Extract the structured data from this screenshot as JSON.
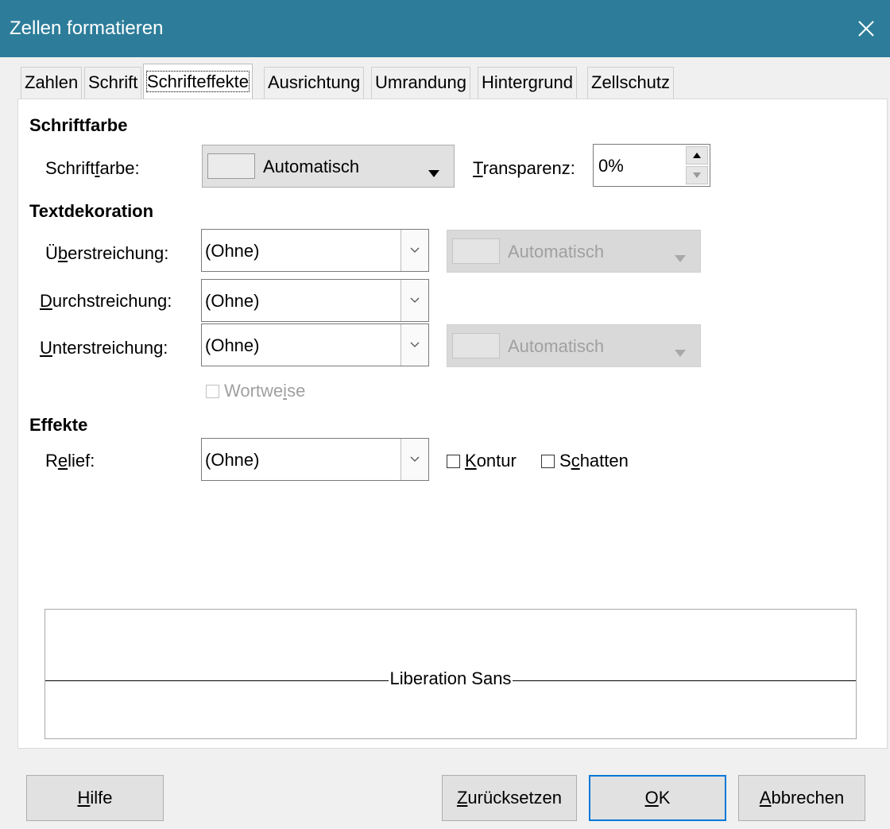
{
  "window": {
    "title": "Zellen formatieren"
  },
  "tabs": [
    "Zahlen",
    "Schrift",
    "Schrifteffekte",
    "Ausrichtung",
    "Umrandung",
    "Hintergrund",
    "Zellschutz"
  ],
  "active_tab": "Schrifteffekte",
  "font_color": {
    "heading": "Schriftfarbe",
    "label_pre": "Schrift",
    "label_acc": "f",
    "label_post": "arbe:",
    "value": "Automatisch",
    "transparency_label_acc": "T",
    "transparency_label_post": "ransparenz:",
    "transparency_value": "0%"
  },
  "decoration": {
    "heading": "Textdekoration",
    "overline": {
      "label_pre": "Ü",
      "label_acc": "b",
      "label_post": "erstreichung:",
      "value": "(Ohne)",
      "color": "Automatisch"
    },
    "strikethrough": {
      "label_acc": "D",
      "label_post": "urchstreichung:",
      "value": "(Ohne)"
    },
    "underline": {
      "label_acc": "U",
      "label_post": "nterstreichung:",
      "value": "(Ohne)",
      "color": "Automatisch"
    },
    "word_by_word": {
      "label_pre": "Wortwe",
      "label_acc": "i",
      "label_post": "se"
    }
  },
  "effects": {
    "heading": "Effekte",
    "relief": {
      "label_pre": "R",
      "label_acc": "e",
      "label_post": "lief:",
      "value": "(Ohne)"
    },
    "outline": {
      "label_acc": "K",
      "label_post": "ontur"
    },
    "shadow": {
      "label_pre": "S",
      "label_acc": "c",
      "label_post": "hatten"
    }
  },
  "preview": {
    "text": "Liberation Sans"
  },
  "buttons": {
    "help": {
      "acc": "H",
      "post": "ilfe"
    },
    "reset": {
      "acc": "Z",
      "post": "urücksetzen"
    },
    "ok": {
      "acc": "O",
      "post": "K"
    },
    "cancel": {
      "acc": "A",
      "post": "bbrechen"
    }
  }
}
